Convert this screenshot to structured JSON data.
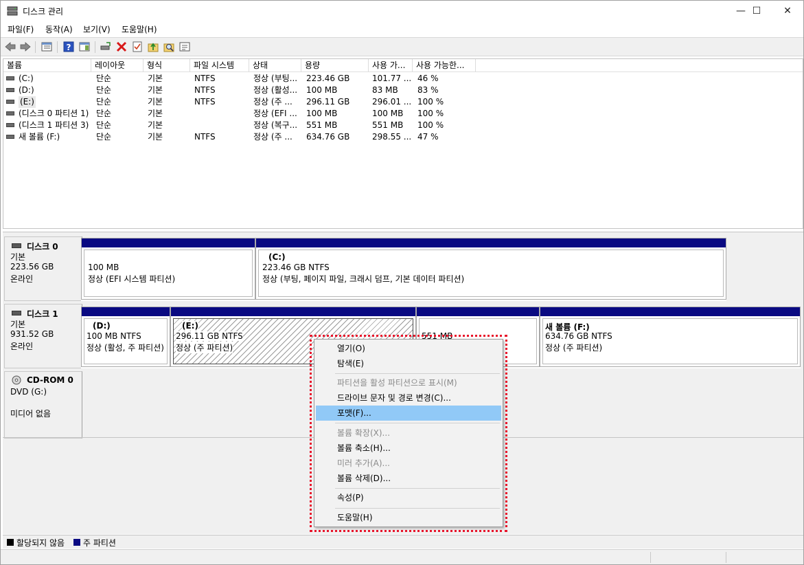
{
  "window": {
    "title": "디스크 관리",
    "minimize": "—",
    "maximize": "☐",
    "close": "✕"
  },
  "menu": [
    "파일(F)",
    "동작(A)",
    "보기(V)",
    "도움말(H)"
  ],
  "toolbar_icons": [
    "back-arrow-icon",
    "forward-arrow-icon",
    "console-tree-icon",
    "help-icon",
    "action-pane-icon",
    "connect-icon",
    "delete-icon",
    "checklist-icon",
    "up-folder-icon",
    "search-folder-icon",
    "properties-icon"
  ],
  "volume_list": {
    "columns": [
      "볼륨",
      "레이아웃",
      "형식",
      "파일 시스템",
      "상태",
      "용량",
      "사용 가...",
      "사용 가능한..."
    ],
    "rows": [
      [
        "(C:)",
        "단순",
        "기본",
        "NTFS",
        "정상 (부팅...",
        "223.46 GB",
        "101.77 ...",
        "46 %"
      ],
      [
        "(D:)",
        "단순",
        "기본",
        "NTFS",
        "정상 (활성...",
        "100 MB",
        "83 MB",
        "83 %"
      ],
      [
        "(E:)",
        "단순",
        "기본",
        "NTFS",
        "정상 (주 ...",
        "296.11 GB",
        "296.01 ...",
        "100 %"
      ],
      [
        "(디스크 0 파티션 1)",
        "단순",
        "기본",
        "",
        "정상 (EFI ...",
        "100 MB",
        "100 MB",
        "100 %"
      ],
      [
        "(디스크 1 파티션 3)",
        "단순",
        "기본",
        "",
        "정상 (복구...",
        "551 MB",
        "551 MB",
        "100 %"
      ],
      [
        "새 볼륨 (F:)",
        "단순",
        "기본",
        "NTFS",
        "정상 (주 ...",
        "634.76 GB",
        "298.55 ...",
        "47 %"
      ]
    ]
  },
  "disks": [
    {
      "name": "디스크 0",
      "type": "기본",
      "size": "223.56 GB",
      "status": "온라인",
      "partitions": [
        {
          "title": "",
          "line1": "100 MB",
          "line2": "정상 (EFI 시스템 파티션)"
        },
        {
          "title": "(C:)",
          "line1": "223.46 GB NTFS",
          "line2": "정상 (부팅, 페이지 파일, 크래시 덤프, 기본 데이터 파티션)"
        }
      ]
    },
    {
      "name": "디스크 1",
      "type": "기본",
      "size": "931.52 GB",
      "status": "온라인",
      "partitions": [
        {
          "title": "(D:)",
          "line1": "100 MB NTFS",
          "line2": "정상 (활성, 주 파티션)"
        },
        {
          "title": "(E:)",
          "line1": "296.11 GB NTFS",
          "line2": "정상 (주 파티션)"
        },
        {
          "title": "",
          "line1": "551 MB",
          "line2": ""
        },
        {
          "title": "새 볼륨  (F:)",
          "line1": "634.76 GB NTFS",
          "line2": "정상 (주 파티션)"
        }
      ]
    },
    {
      "name": "CD-ROM 0",
      "type": "DVD (G:)",
      "size": "",
      "status": "미디어 없음"
    }
  ],
  "legend": [
    {
      "label": "할당되지 않음",
      "color": "#000000"
    },
    {
      "label": "주 파티션",
      "color": "#0a0a82"
    }
  ],
  "context_menu": {
    "items": [
      {
        "label": "열기(O)",
        "enabled": true
      },
      {
        "label": "탐색(E)",
        "enabled": true
      },
      {
        "label": "파티션을 활성 파티션으로 표시(M)",
        "enabled": false
      },
      {
        "label": "드라이브 문자 및 경로 변경(C)...",
        "enabled": true
      },
      {
        "label": "포맷(F)...",
        "enabled": true,
        "highlighted": true
      },
      {
        "label": "볼륨 확장(X)...",
        "enabled": false
      },
      {
        "label": "볼륨 축소(H)...",
        "enabled": true
      },
      {
        "label": "미러 추가(A)...",
        "enabled": false
      },
      {
        "label": "볼륨 삭제(D)...",
        "enabled": true
      },
      {
        "label": "속성(P)",
        "enabled": true
      },
      {
        "label": "도움말(H)",
        "enabled": true
      }
    ]
  },
  "colors": {
    "primary_partition": "#0a0a82",
    "highlight": "#91c9f7",
    "annotation_outline": "#e8132a"
  }
}
